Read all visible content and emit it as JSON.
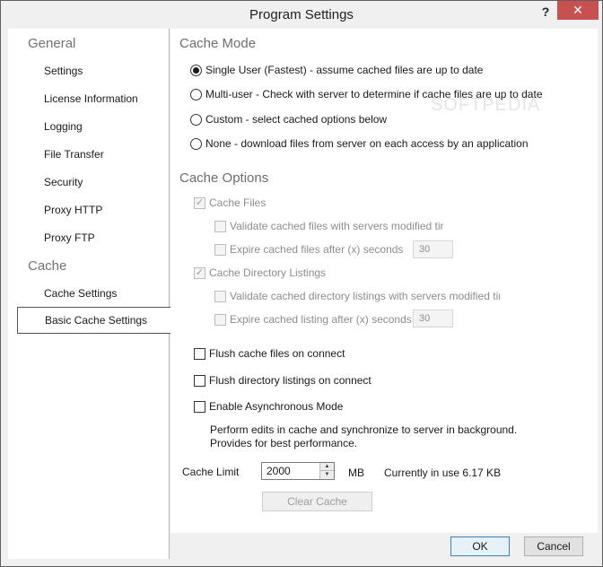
{
  "window": {
    "title": "Program Settings",
    "help_label": "?",
    "close_label": "✕"
  },
  "sidebar": {
    "groups": [
      {
        "label": "General"
      },
      {
        "label": "Cache"
      }
    ],
    "items": [
      {
        "label": "Settings"
      },
      {
        "label": "License Information"
      },
      {
        "label": "Logging"
      },
      {
        "label": "File Transfer"
      },
      {
        "label": "Security"
      },
      {
        "label": "Proxy HTTP"
      },
      {
        "label": "Proxy FTP"
      },
      {
        "label": "Cache Settings"
      },
      {
        "label": "Basic Cache Settings",
        "selected": true
      }
    ]
  },
  "cache_mode": {
    "heading": "Cache Mode",
    "options": [
      {
        "label": "Single User (Fastest) - assume cached files are up to date",
        "checked": true
      },
      {
        "label": "Multi-user - Check with server to determine if cache files are up to date",
        "checked": false
      },
      {
        "label": "Custom - select cached options below",
        "checked": false
      },
      {
        "label": "None - download files from server on each access by an application",
        "checked": false
      }
    ]
  },
  "cache_options": {
    "heading": "Cache Options",
    "cache_files": {
      "label": "Cache Files",
      "checked": true
    },
    "validate_files": {
      "label": "Validate cached files with servers modified tir",
      "checked": false
    },
    "expire_files": {
      "label": "Expire cached files after (x) seconds",
      "checked": false,
      "value": "30"
    },
    "cache_dirs": {
      "label": "Cache Directory Listings",
      "checked": true
    },
    "validate_dirs": {
      "label": "Validate cached directory listings with servers modified tir",
      "checked": false
    },
    "expire_dirs": {
      "label": "Expire cached listing after (x) seconds",
      "checked": false,
      "value": "30"
    }
  },
  "flush_files": {
    "label": "Flush cache files on connect",
    "checked": false
  },
  "flush_dirs": {
    "label": "Flush directory listings on connect",
    "checked": false
  },
  "async_mode": {
    "label": "Enable Asynchronous Mode",
    "checked": false,
    "description_line1": "Perform edits in cache and synchronize to server in background.",
    "description_line2": "Provides for best performance."
  },
  "cache_limit": {
    "label": "Cache Limit",
    "value": "2000",
    "unit": "MB",
    "in_use": "Currently in use 6.17 KB"
  },
  "buttons": {
    "clear_cache": "Clear Cache",
    "ok": "OK",
    "cancel": "Cancel"
  },
  "watermark": "SOFTPEDIA"
}
